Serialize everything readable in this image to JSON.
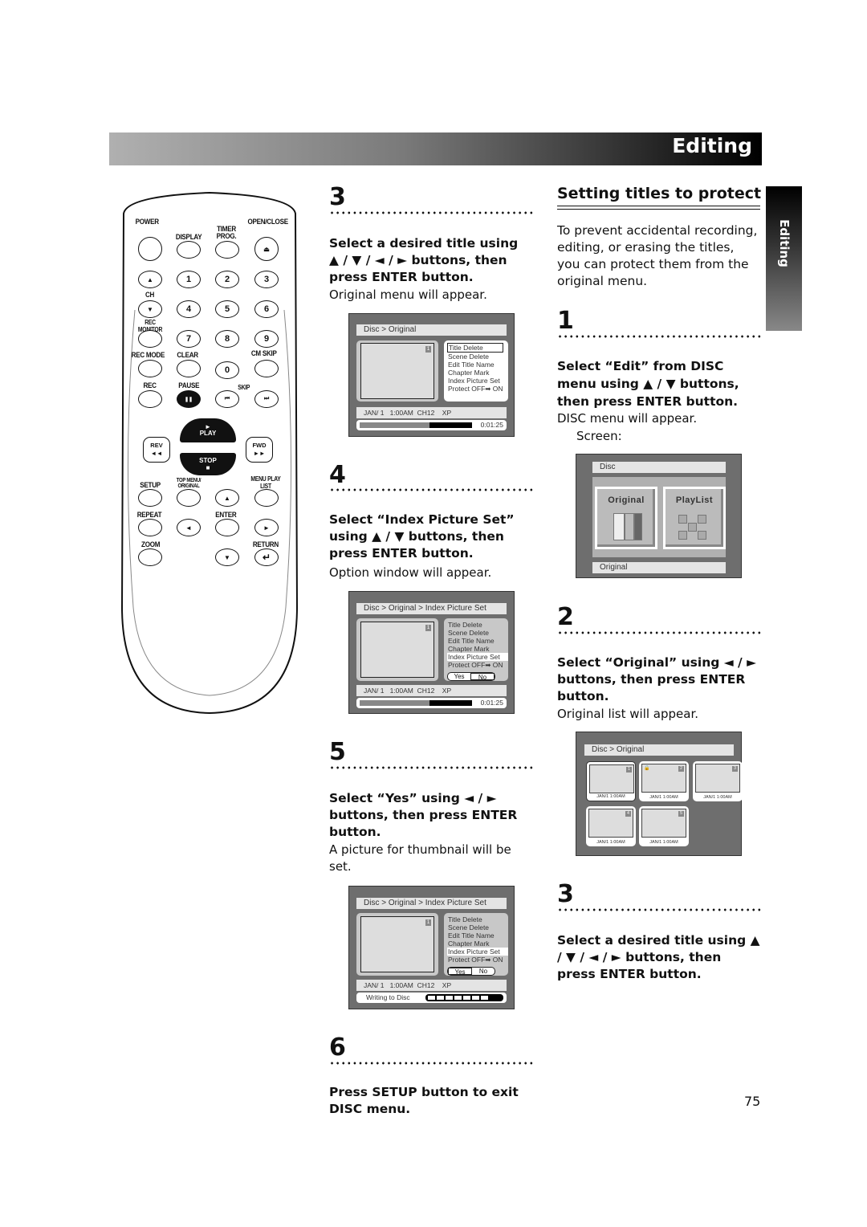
{
  "header": {
    "title": "Editing"
  },
  "side_tab": {
    "label": "Editing"
  },
  "page_number": "75",
  "remote": {
    "labels": {
      "power": "POWER",
      "display": "DISPLAY",
      "timer_prog": "TIMER PROG.",
      "open_close": "OPEN/CLOSE",
      "ch": "CH",
      "rec_monitor": "REC MONITOR",
      "rec_mode": "REC MODE",
      "clear": "CLEAR",
      "cm_skip": "CM SKIP",
      "rec": "REC",
      "pause": "PAUSE",
      "skip": "SKIP",
      "play": "PLAY",
      "stop": "STOP",
      "rev": "REV",
      "fwd": "FWD",
      "setup": "SETUP",
      "top_menu": "TOP MENU/ ORIGINAL",
      "menu": "MENU PLAY LIST",
      "repeat": "REPEAT",
      "enter": "ENTER",
      "zoom": "ZOOM",
      "return": "RETURN"
    },
    "digits": [
      "1",
      "2",
      "3",
      "4",
      "5",
      "6",
      "7",
      "8",
      "9",
      "0"
    ],
    "glyphs": {
      "up": "▲",
      "down": "▼",
      "left": "◄",
      "right": "►",
      "eject": "⏏",
      "pause": "❚❚",
      "prev": "⏮",
      "next": "⏭",
      "rev": "◄◄",
      "fwd": "►►",
      "play": "►",
      "stop": "■",
      "return": "↵"
    }
  },
  "left_column": {
    "steps": [
      {
        "number": "3",
        "instruction": "Select a desired title using ▲ / ▼ / ◄ / ► buttons, then press ENTER button.",
        "note": "Original menu will appear.",
        "screen": {
          "breadcrumb": "Disc > Original",
          "thumb_number": "1",
          "menu": [
            "Title Delete",
            "Scene Delete",
            "Edit Title Name",
            "Chapter Mark",
            "Index Picture Set",
            "Protect OFF➡ ON"
          ],
          "highlighted": "Title Delete",
          "status": "JAN/ 1   1:00AM  CH12    XP",
          "progress": 0.62,
          "time": "0:01:25"
        }
      },
      {
        "number": "4",
        "instruction": "Select “Index Picture Set” using ▲ / ▼ buttons, then press ENTER button.",
        "note": "Option window will appear.",
        "screen": {
          "breadcrumb": "Disc > Original > Index Picture Set",
          "thumb_number": "1",
          "menu": [
            "Title Delete",
            "Scene Delete",
            "Edit Title Name",
            "Chapter Mark",
            "Index Picture Set",
            "Protect OFF➡ ON"
          ],
          "highlighted": "Index Picture Set",
          "options": [
            "Yes",
            "No"
          ],
          "selected_option": "No",
          "status": "JAN/ 1   1:00AM  CH12    XP",
          "progress": 0.62,
          "time": "0:01:25"
        }
      },
      {
        "number": "5",
        "instruction": "Select “Yes” using ◄ / ► buttons, then press ENTER button.",
        "note": "A picture for thumbnail will be set.",
        "screen": {
          "breadcrumb": "Disc > Original > Index Picture Set",
          "thumb_number": "1",
          "menu": [
            "Title Delete",
            "Scene Delete",
            "Edit Title Name",
            "Chapter Mark",
            "Index Picture Set",
            "Protect OFF➡ ON"
          ],
          "highlighted": "Index Picture Set",
          "options": [
            "Yes",
            "No"
          ],
          "selected_option": "Yes",
          "status": "JAN/ 1   1:00AM  CH12    XP",
          "writing_label": "Writing to Disc",
          "writing_segments": 7
        }
      },
      {
        "number": "6",
        "instruction": "Press SETUP button to exit DISC menu."
      }
    ]
  },
  "right_column": {
    "section_title": "Setting titles to protect",
    "intro": "To prevent accidental recording, editing, or erasing the titles, you can protect them from the original menu.",
    "steps": [
      {
        "number": "1",
        "instruction": "Select “Edit” from DISC menu using ▲ / ▼ buttons, then press ENTER button.",
        "note": "DISC menu will appear.",
        "note2": "Screen:",
        "screen": {
          "top_bar": "Disc",
          "buttons": [
            "Original",
            "PlayList"
          ],
          "selected": "Original",
          "bottom_bar": "Original"
        }
      },
      {
        "number": "2",
        "instruction": "Select “Original” using ◄ / ► buttons, then press ENTER button.",
        "note": "Original list will appear.",
        "screen": {
          "breadcrumb": "Disc > Original",
          "titles": [
            {
              "number": "1",
              "date": "JAN/1   1:00AM",
              "protected": false,
              "selected": true
            },
            {
              "number": "2",
              "date": "JAN/1   1:00AM",
              "protected": true,
              "selected": false
            },
            {
              "number": "3",
              "date": "JAN/1   1:00AM",
              "protected": false,
              "selected": false
            },
            {
              "number": "4",
              "date": "JAN/1   1:00AM",
              "protected": false,
              "selected": false
            },
            {
              "number": "5",
              "date": "JAN/1   1:00AM",
              "protected": false,
              "selected": false
            }
          ]
        }
      },
      {
        "number": "3",
        "instruction": "Select a desired title using ▲ / ▼ / ◄ / ► buttons, then press ENTER button."
      }
    ]
  }
}
